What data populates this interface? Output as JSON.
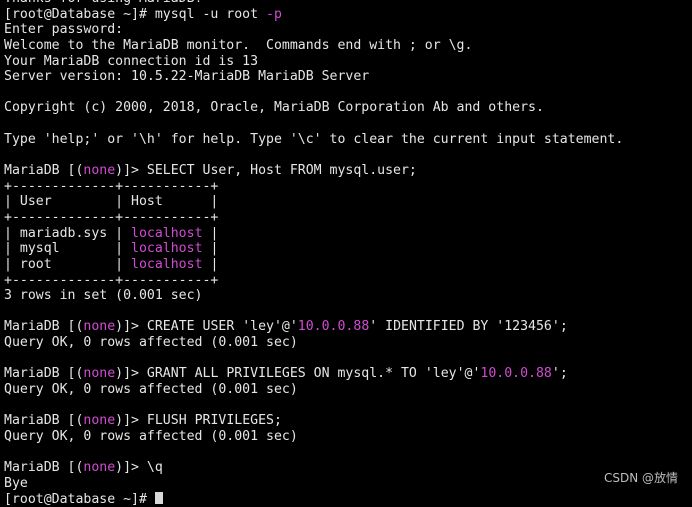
{
  "colors": {
    "background": "#000000",
    "foreground": "#e6e6e6",
    "highlight": "#d04cd0"
  },
  "terminal": {
    "lines": [
      "Thanks for using MariaDB!",
      "[root@Database ~]# mysql -u root -p",
      "Enter password:",
      "Welcome to the MariaDB monitor.  Commands end with ; or \\g.",
      "Your MariaDB connection id is 13",
      "Server version: 10.5.22-MariaDB MariaDB Server",
      "",
      "Copyright (c) 2000, 2018, Oracle, MariaDB Corporation Ab and others.",
      "",
      "Type 'help;' or '\\h' for help. Type '\\c' to clear the current input statement.",
      "",
      "MariaDB [(none)]> SELECT User, Host FROM mysql.user;",
      "+-------------+-----------+",
      "| User        | Host      |",
      "+-------------+-----------+",
      "| mariadb.sys | localhost |",
      "| mysql       | localhost |",
      "| root        | localhost |",
      "+-------------+-----------+",
      "3 rows in set (0.001 sec)",
      "",
      "MariaDB [(none)]> CREATE USER 'ley'@'10.0.0.88' IDENTIFIED BY '123456';",
      "Query OK, 0 rows affected (0.001 sec)",
      "",
      "MariaDB [(none)]> GRANT ALL PRIVILEGES ON mysql.* TO 'ley'@'10.0.0.88';",
      "Query OK, 0 rows affected (0.001 sec)",
      "",
      "MariaDB [(none)]> FLUSH PRIVILEGES;",
      "Query OK, 0 rows affected (0.001 sec)",
      "",
      "MariaDB [(none)]> \\q",
      "Bye",
      "[root@Database ~]# "
    ],
    "highlight_tokens": [
      "none",
      "-p",
      "localhost",
      "10.0.0.88"
    ]
  },
  "watermark": "CSDN @放情"
}
